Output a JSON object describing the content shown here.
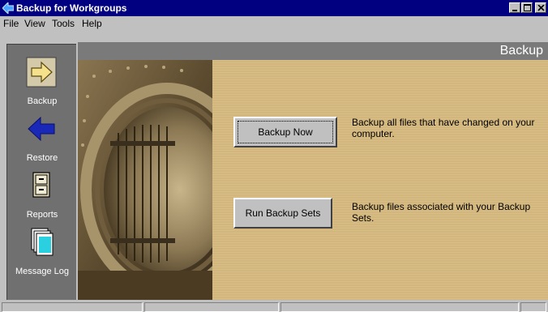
{
  "window": {
    "title": "Backup for Workgroups"
  },
  "menu": {
    "items": [
      {
        "label": "File"
      },
      {
        "label": "View"
      },
      {
        "label": "Tools"
      },
      {
        "label": "Help"
      }
    ]
  },
  "sidebar": {
    "items": [
      {
        "label": "Backup",
        "icon": "right-arrow-icon"
      },
      {
        "label": "Restore",
        "icon": "left-arrow-icon"
      },
      {
        "label": "Reports",
        "icon": "file-cabinet-icon"
      },
      {
        "label": "Message Log",
        "icon": "documents-icon"
      }
    ]
  },
  "header": {
    "title": "Backup"
  },
  "actions": {
    "backup_now": {
      "label": "Backup Now",
      "description": "Backup all files that have changed on your computer."
    },
    "run_backup_sets": {
      "label": "Run Backup Sets",
      "description": "Backup files associated with your Backup Sets."
    }
  },
  "colors": {
    "titlebar": "#000080",
    "sidebar": "#707070",
    "panel": "#d3b67b",
    "header_band": "#7a7a7a"
  }
}
